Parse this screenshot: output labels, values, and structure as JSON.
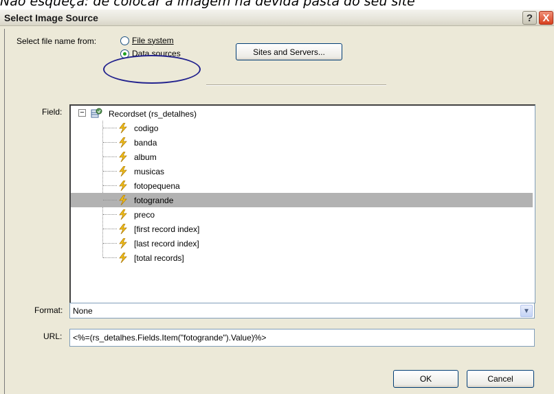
{
  "caption": "Não esqueça: de colocar a imagem na devida pasta do seu site",
  "window": {
    "title": "Select Image Source",
    "help_label": "?",
    "close_label": "X"
  },
  "source": {
    "label": "Select file name from:",
    "options": [
      "File system",
      "Data sources"
    ],
    "selected": "Data sources",
    "sites_button": "Sites and Servers..."
  },
  "field": {
    "label": "Field:",
    "root": "Recordset (rs_detalhes)",
    "expander": "−",
    "items": [
      "codigo",
      "banda",
      "album",
      "musicas",
      "fotopequena",
      "fotogrande",
      "preco",
      "[first record index]",
      "[last record index]",
      "[total records]"
    ],
    "selected_item": "fotogrande"
  },
  "format": {
    "label": "Format:",
    "value": "None"
  },
  "url": {
    "label": "URL:",
    "value": "<%=(rs_detalhes.Fields.Item(\"fotogrande\").Value)%>"
  },
  "buttons": {
    "ok": "OK",
    "cancel": "Cancel"
  },
  "colors": {
    "dialog_bg": "#ece9d8",
    "selection": "#b2b2b2",
    "annotation_ellipse": "#23238e",
    "radio_dot": "#21a121",
    "bolt": "#f4c21a"
  }
}
